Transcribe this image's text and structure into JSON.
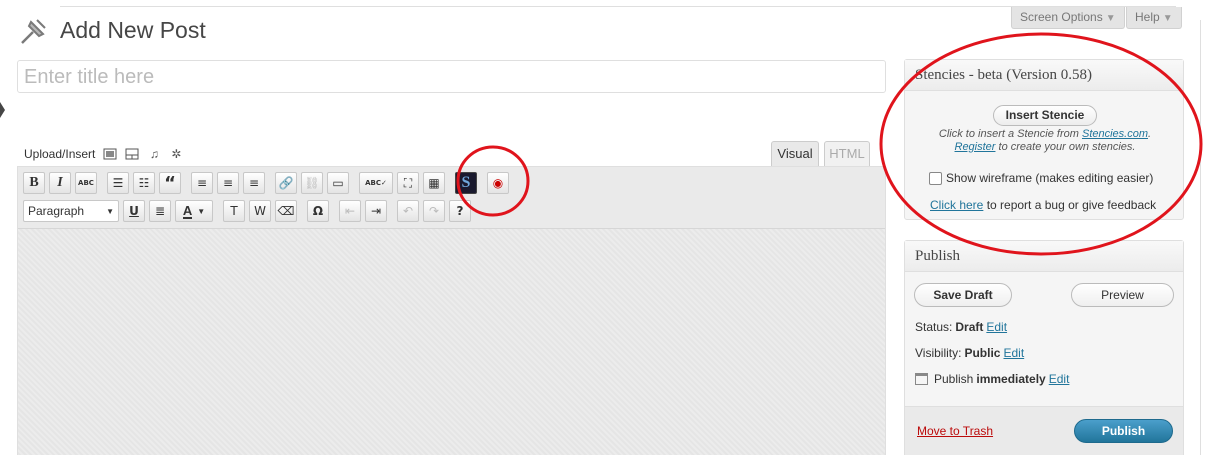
{
  "header": {
    "title": "Add New Post",
    "screen_options": "Screen Options",
    "help": "Help",
    "dropdown_arrow": "▼"
  },
  "title_field": {
    "placeholder": "Enter title here"
  },
  "media": {
    "upload_insert": "Upload/Insert",
    "icons": [
      "image-icon",
      "video-icon",
      "audio-icon",
      "media-icon"
    ]
  },
  "editor": {
    "tab_visual": "Visual",
    "tab_html": "HTML",
    "format_select": "Paragraph",
    "toolbar_row1": [
      {
        "name": "bold-button",
        "glyph": "B"
      },
      {
        "name": "italic-button",
        "glyph": "I"
      },
      {
        "name": "strikethrough-button",
        "glyph": "ABC"
      },
      {
        "name": "bullet-list-button",
        "glyph": "☰"
      },
      {
        "name": "numbered-list-button",
        "glyph": "☷"
      },
      {
        "name": "blockquote-button",
        "glyph": "“"
      },
      {
        "name": "align-left-button",
        "glyph": "≡"
      },
      {
        "name": "align-center-button",
        "glyph": "≡"
      },
      {
        "name": "align-right-button",
        "glyph": "≡"
      },
      {
        "name": "insert-link-button",
        "glyph": "🔗"
      },
      {
        "name": "unlink-button",
        "glyph": "⛓"
      },
      {
        "name": "more-tag-button",
        "glyph": "▭"
      },
      {
        "name": "spellcheck-button",
        "glyph": "ABC✓"
      },
      {
        "name": "fullscreen-button",
        "glyph": "⛶"
      },
      {
        "name": "kitchen-sink-button",
        "glyph": "▦"
      },
      {
        "name": "stencie-button",
        "glyph": "S"
      },
      {
        "name": "wireframe-button",
        "glyph": "◉"
      }
    ],
    "toolbar_row2_glyphs": {
      "underline": "U",
      "justify": "≣",
      "text_color": "A",
      "paste_text": "T",
      "paste_word": "W",
      "remove_format": "⌫",
      "special_char": "Ω",
      "outdent": "⇤",
      "indent": "⇥",
      "undo": "↶",
      "redo": "↷",
      "help": "?"
    }
  },
  "stencies_panel": {
    "title": "Stencies - beta (Version 0.58)",
    "insert_button": "Insert Stencie",
    "note_prefix": "Click to insert a Stencie from ",
    "note_link": "Stencies.com",
    "note_dot": ".",
    "register_link": "Register",
    "note_suffix": " to create your own stencies.",
    "wireframe_label": "Show wireframe (makes editing easier)",
    "report_link": "Click here",
    "report_suffix": " to report a bug or give feedback"
  },
  "publish_panel": {
    "title": "Publish",
    "save_draft": "Save Draft",
    "preview": "Preview",
    "status_label": "Status: ",
    "status_value": "Draft",
    "visibility_label": "Visibility: ",
    "visibility_value": "Public",
    "publish_label": "Publish ",
    "publish_value": "immediately",
    "edit": "Edit",
    "trash": "Move to Trash",
    "publish_button": "Publish"
  },
  "colors": {
    "annotation_red": "#e0141c",
    "link_blue": "#21759b",
    "trash_red": "#bc0b0b",
    "publish_blue": "#21759b"
  }
}
